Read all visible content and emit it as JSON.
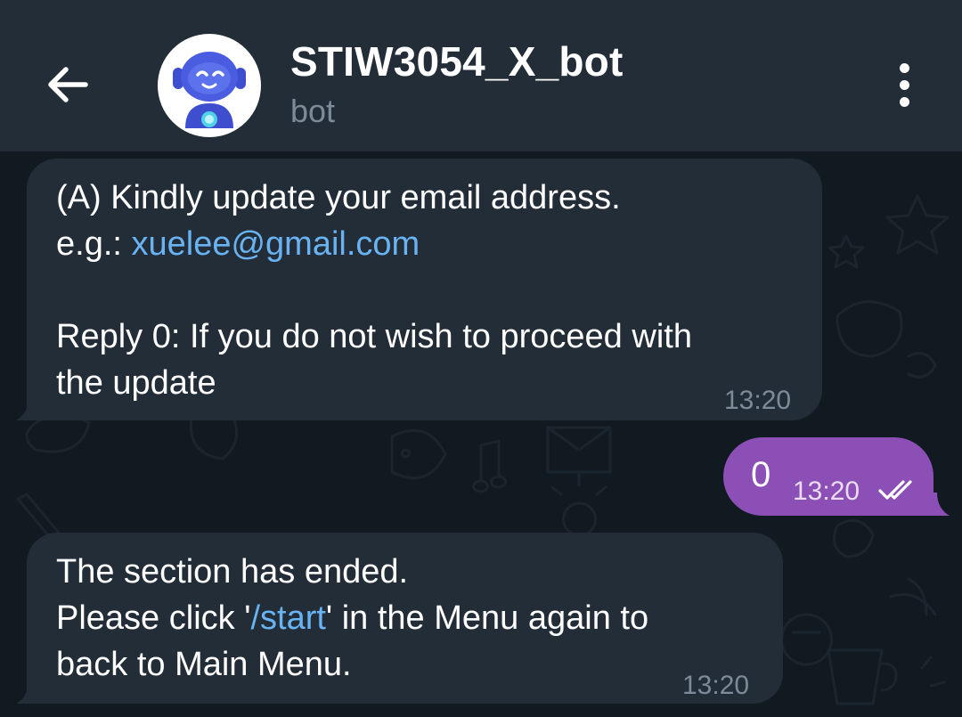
{
  "header": {
    "title": "STIW3054_X_bot",
    "subtitle": "bot",
    "back_icon": "arrow-left-icon",
    "menu_icon": "more-vertical-icon",
    "avatar_icon": "robot-avatar-icon"
  },
  "messages": [
    {
      "direction": "incoming",
      "lines": [
        {
          "text": "(A) Kindly update your email address."
        },
        {
          "prefix": "e.g.: ",
          "link": "xuelee@gmail.com"
        },
        {
          "text": ""
        },
        {
          "text": "Reply 0: If you do not wish to proceed with"
        },
        {
          "text": "the update"
        }
      ],
      "time": "13:20"
    },
    {
      "direction": "outgoing",
      "text": "0",
      "time": "13:20",
      "status_icon": "double-check-icon"
    },
    {
      "direction": "incoming",
      "lines": [
        {
          "text": "The section has ended."
        },
        {
          "prefix": "Please click '",
          "link": "/start",
          "suffix": "' in the Menu again to"
        },
        {
          "text": "back to Main Menu."
        }
      ],
      "time": "13:20"
    }
  ],
  "colors": {
    "header_bg": "#222d38",
    "chat_bg": "#121a21",
    "incoming_bubble": "#222d38",
    "outgoing_bubble": "#8c4fb5",
    "link": "#6ab3f3",
    "muted_text": "#7d8b99"
  }
}
